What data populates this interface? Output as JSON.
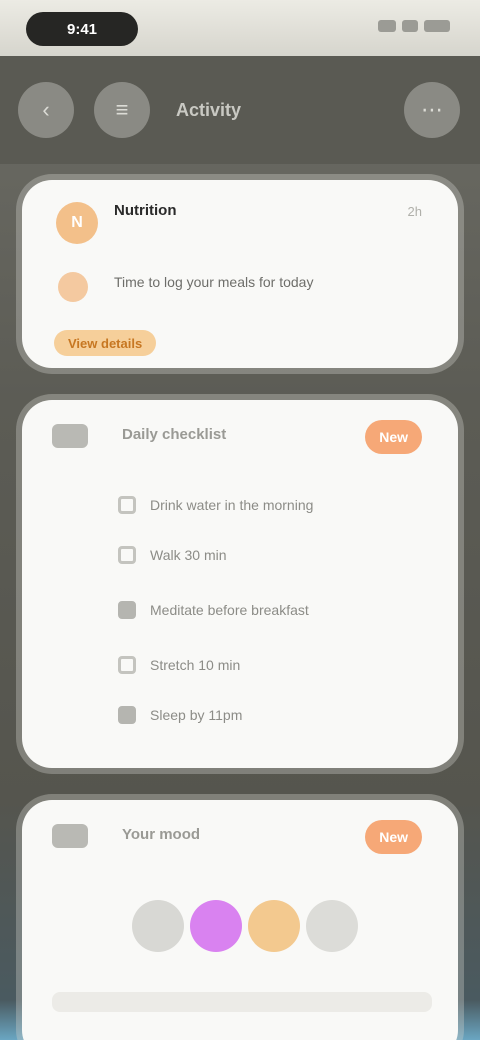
{
  "status": {
    "time": "9:41"
  },
  "nav": {
    "back_icon": "back-arrow-icon",
    "menu_icon": "menu-icon",
    "title": "Activity",
    "more_icon": "more-icon"
  },
  "card1": {
    "author": "Nutrition",
    "time": "2h",
    "avatar": "N",
    "body": "Time to log your meals for today",
    "link": "View details"
  },
  "card2": {
    "title": "Daily checklist",
    "badge": "New",
    "items": [
      {
        "label": "Drink water in the morning",
        "checked": false
      },
      {
        "label": "Walk 30 min",
        "checked": false
      },
      {
        "label": "Meditate before breakfast",
        "checked": true
      },
      {
        "label": "Stretch 10 min",
        "checked": false
      },
      {
        "label": "Sleep by 11pm",
        "checked": true
      }
    ]
  },
  "card3": {
    "title": "Your mood",
    "badge": "New",
    "chips": [
      {
        "label": "",
        "color": "#d8d8d4"
      },
      {
        "label": "",
        "color": "#d982f0"
      },
      {
        "label": "",
        "color": "#f3c98f"
      },
      {
        "label": "",
        "color": "#dcdcd8"
      }
    ]
  }
}
